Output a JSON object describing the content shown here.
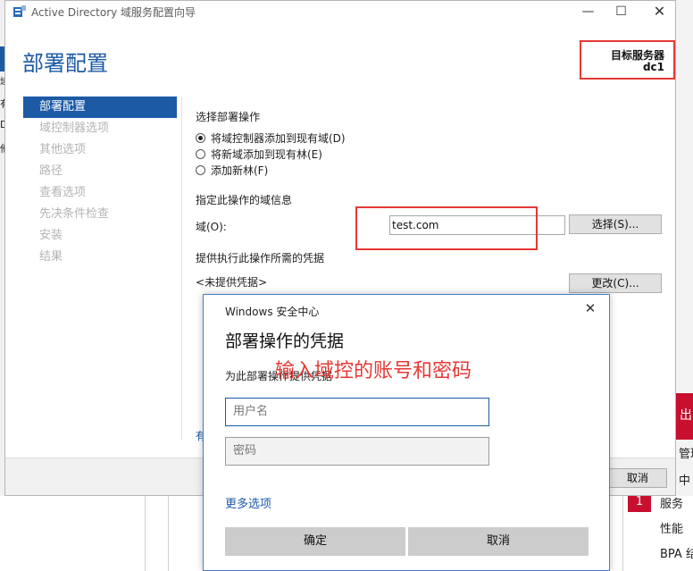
{
  "window": {
    "title": "Active Directory 域服务配置向导",
    "minimize": "—",
    "maximize": "☐",
    "close": "✕"
  },
  "page": {
    "title": "部署配置",
    "target_label": "目标服务器",
    "target_value": "dc1"
  },
  "nav": {
    "items": [
      "部署配置",
      "域控制器选项",
      "其他选项",
      "路径",
      "查看选项",
      "先决条件检查",
      "安装",
      "结果"
    ],
    "active_index": 0
  },
  "main": {
    "op_label": "选择部署操作",
    "options": [
      "将域控制器添加到现有域(D)",
      "将新域添加到现有林(E)",
      "添加新林(F)"
    ],
    "selected_option": 0,
    "domain_info_label": "指定此操作的域信息",
    "domain_label": "域(O):",
    "domain_value": "test.com",
    "select_button": "选择(S)...",
    "cred_label": "提供执行此操作所需的凭据",
    "cred_value": "<未提供凭据>",
    "change_button": "更改(C)...",
    "link_partial": "有"
  },
  "footer": {
    "cancel_button": "取消"
  },
  "dialog": {
    "title": "Windows 安全中心",
    "close": "✕",
    "heading": "部署操作的凭据",
    "description": "为此部署操作提供凭据",
    "annotation": "输入域控的账号和密码",
    "username_placeholder": "用户名",
    "password_placeholder": "密码",
    "more_options": "更多选项",
    "ok_button": "确定",
    "cancel_button": "取消"
  },
  "background": {
    "left_fragments": [
      "域",
      "有",
      "D",
      "他"
    ],
    "right_red_text": "出",
    "right_fragments": [
      "管理",
      "中"
    ],
    "badge": "1",
    "labels": [
      "服务",
      "性能",
      "BPA 结"
    ]
  }
}
